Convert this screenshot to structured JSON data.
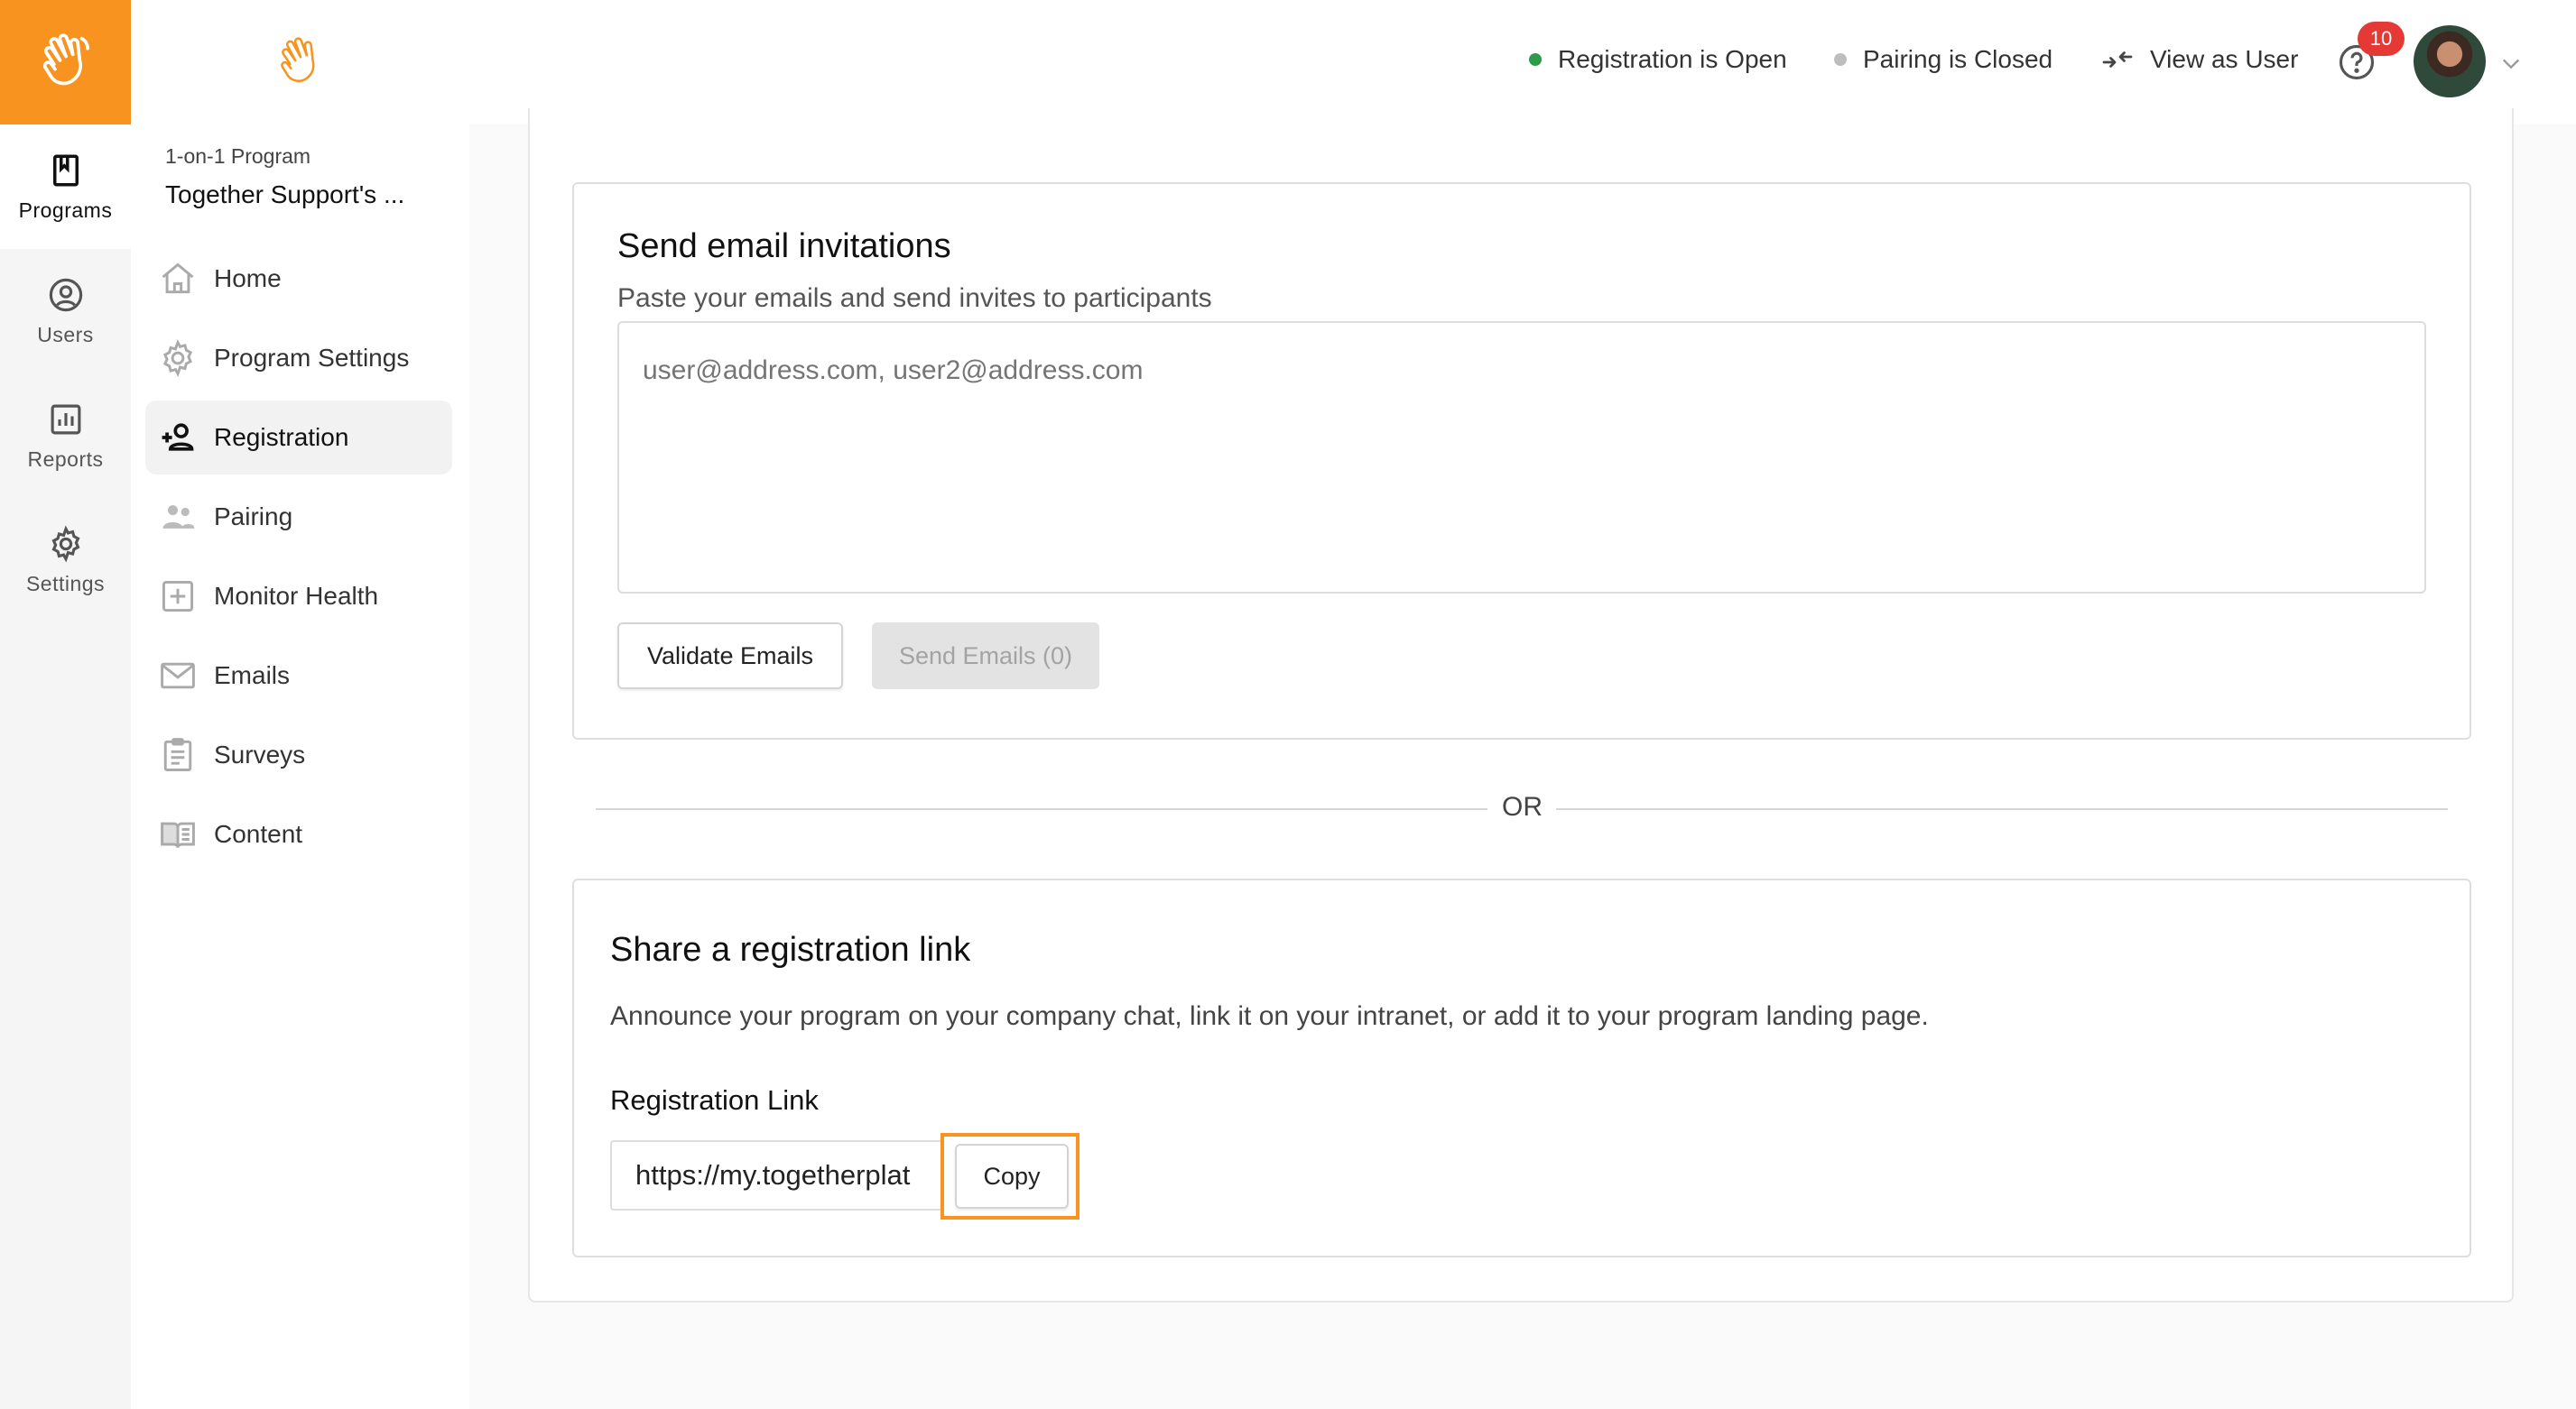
{
  "rail": {
    "items": [
      {
        "label": "Programs",
        "icon": "bookmark-icon",
        "active": true
      },
      {
        "label": "Users",
        "icon": "user-circle-icon",
        "active": false
      },
      {
        "label": "Reports",
        "icon": "bar-chart-icon",
        "active": false
      },
      {
        "label": "Settings",
        "icon": "gear-icon",
        "active": false
      }
    ]
  },
  "sidebar": {
    "program_kind": "1-on-1 Program",
    "program_name": "Together Support's ...",
    "items": [
      {
        "label": "Home",
        "icon": "home-icon"
      },
      {
        "label": "Program Settings",
        "icon": "gear-icon"
      },
      {
        "label": "Registration",
        "icon": "add-person-icon",
        "active": true
      },
      {
        "label": "Pairing",
        "icon": "people-icon"
      },
      {
        "label": "Monitor Health",
        "icon": "plus-square-icon"
      },
      {
        "label": "Emails",
        "icon": "envelope-icon"
      },
      {
        "label": "Surveys",
        "icon": "clipboard-icon"
      },
      {
        "label": "Content",
        "icon": "book-icon"
      }
    ]
  },
  "topbar": {
    "registration_status": "Registration is Open",
    "pairing_status": "Pairing is Closed",
    "view_as_user": "View as User",
    "notification_count": "10",
    "colors": {
      "open": "#2e9b4a",
      "closed": "#bdbdbd"
    }
  },
  "invite": {
    "title": "Send email invitations",
    "subtitle": "Paste your emails and send invites to participants",
    "placeholder": "user@address.com, user2@address.com",
    "validate_label": "Validate Emails",
    "send_label": "Send Emails (0)"
  },
  "divider": {
    "label": "OR"
  },
  "share": {
    "title": "Share a registration link",
    "description": "Announce your program on your company chat, link it on your intranet, or add it to your program landing page.",
    "link_label": "Registration Link",
    "link_value": "https://my.togetherplat",
    "copy_label": "Copy"
  },
  "colors": {
    "brand": "#f7931e",
    "badge": "#e53935"
  }
}
